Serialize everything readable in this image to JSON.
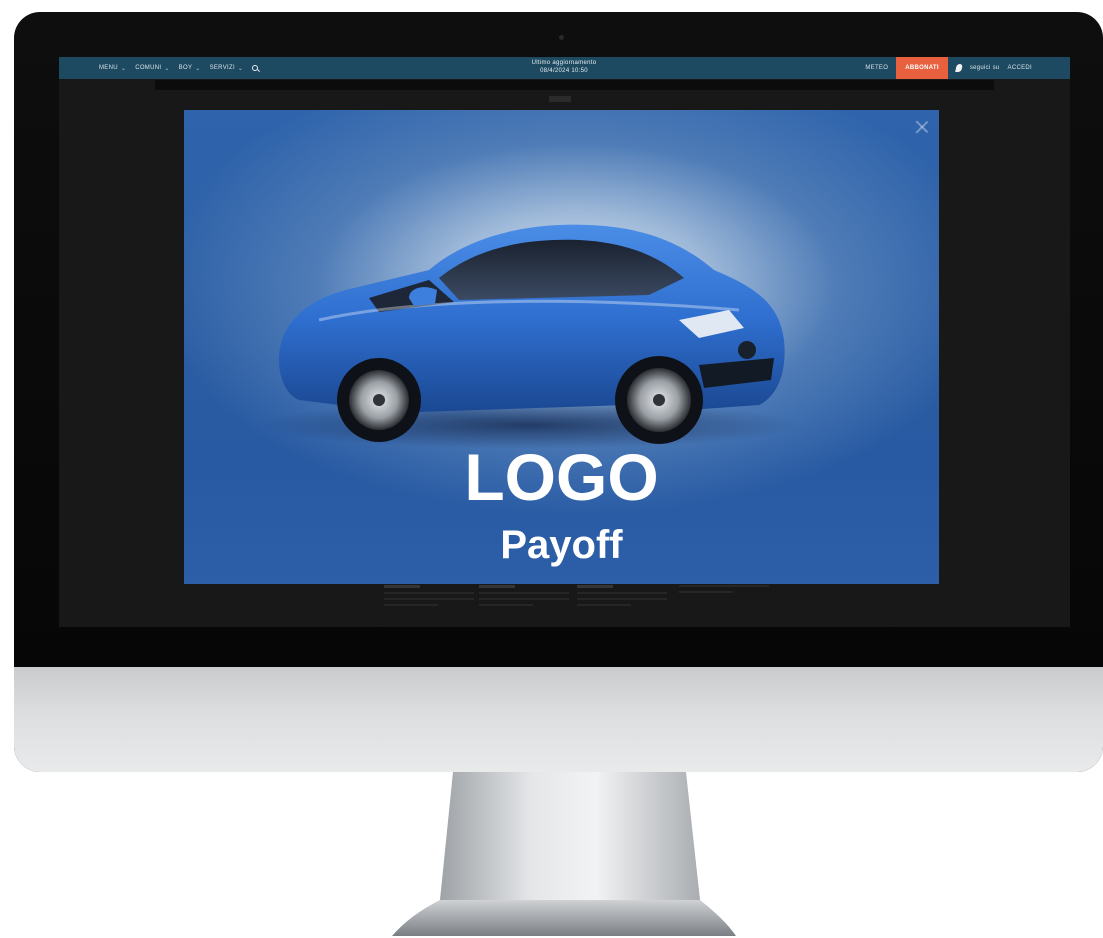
{
  "nav": {
    "items": [
      {
        "label": "MENU"
      },
      {
        "label": "COMUNI"
      },
      {
        "label": "BOY"
      },
      {
        "label": "SERVIZI"
      }
    ],
    "chevron": "⌄",
    "update_line1": "Ultimo aggiornamento",
    "update_line2": "08/4/2024 10:50",
    "meteo": "METEO",
    "abbonati": "ABBONATI",
    "seguici": "seguici su",
    "accedi": "ACCEDI"
  },
  "popup": {
    "logo": "LOGO",
    "payoff": "Payoff"
  },
  "colors": {
    "nav_bg": "#1d4a60",
    "abbonati_bg": "#e9603f",
    "banner_blue": "#2c5fa8",
    "car_blue": "#2f6fd0"
  },
  "icons": [
    "search-icon",
    "close-icon",
    "social-icon",
    "chevron-down-icon"
  ]
}
